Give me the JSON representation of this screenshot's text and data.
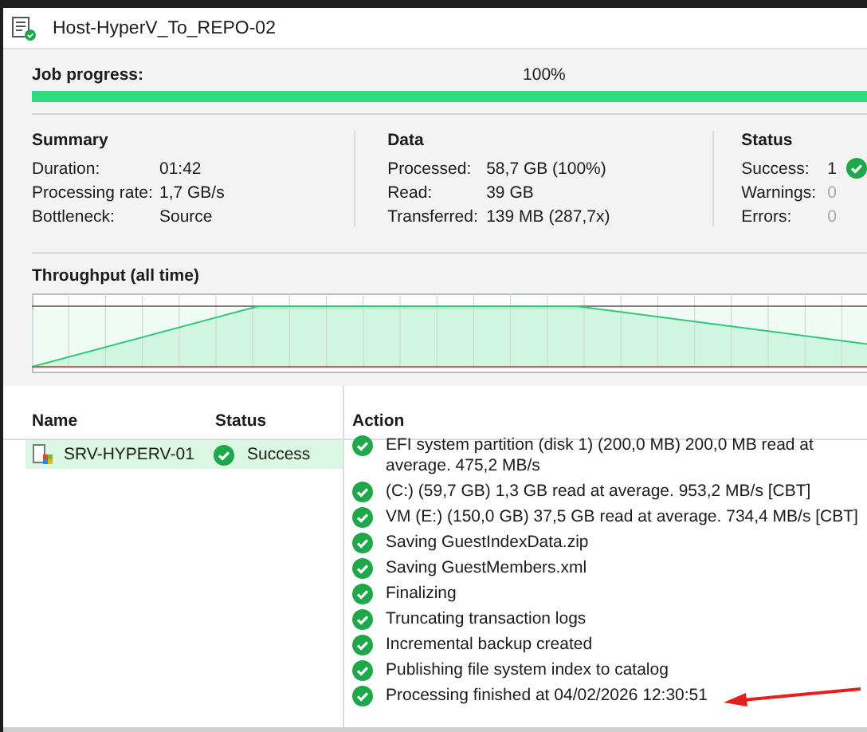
{
  "window": {
    "title": "Host-HyperV_To_REPO-02"
  },
  "job_progress": {
    "label": "Job progress:",
    "percent": "100%",
    "level": 1
  },
  "summary": {
    "title": "Summary",
    "rows": [
      {
        "label": "Duration:",
        "value": "01:42"
      },
      {
        "label": "Processing rate:",
        "value": "1,7 GB/s"
      },
      {
        "label": "Bottleneck:",
        "value": "Source"
      }
    ]
  },
  "data": {
    "title": "Data",
    "rows": [
      {
        "label": "Processed:",
        "value": "58,7 GB (100%)"
      },
      {
        "label": "Read:",
        "value": "39 GB"
      },
      {
        "label": "Transferred:",
        "value": "139 MB (287,7x)"
      }
    ]
  },
  "status": {
    "title": "Status",
    "rows": [
      {
        "label": "Success:",
        "value": "1",
        "kind": "success",
        "dimmed": false
      },
      {
        "label": "Warnings:",
        "value": "0",
        "kind": "warning",
        "dimmed": true
      },
      {
        "label": "Errors:",
        "value": "0",
        "kind": "error",
        "dimmed": true
      }
    ]
  },
  "throughput": {
    "title": "Throughput (all time)"
  },
  "vm_table": {
    "columns": [
      "Name",
      "Status"
    ],
    "rows": [
      {
        "name": "SRV-HYPERV-01",
        "status": "Success",
        "selected": true
      }
    ]
  },
  "action_log": {
    "title": "Action",
    "items": [
      {
        "text": "EFI system partition (disk 1) (200,0 MB) 200,0 MB read at average. 475,2 MB/s",
        "kind": "success",
        "annotated": false
      },
      {
        "text": "(C:) (59,7 GB) 1,3 GB read at average. 953,2 MB/s [CBT]",
        "kind": "success",
        "annotated": false
      },
      {
        "text": "VM (E:) (150,0 GB) 37,5 GB read at average. 734,4 MB/s [CBT]",
        "kind": "success",
        "annotated": false
      },
      {
        "text": "Saving GuestIndexData.zip",
        "kind": "success",
        "annotated": false
      },
      {
        "text": "Saving GuestMembers.xml",
        "kind": "success",
        "annotated": false
      },
      {
        "text": "Finalizing",
        "kind": "success",
        "annotated": false
      },
      {
        "text": "Truncating transaction logs",
        "kind": "success",
        "annotated": false
      },
      {
        "text": "Incremental backup created",
        "kind": "success",
        "annotated": false
      },
      {
        "text": "Publishing file system index to catalog",
        "kind": "success",
        "annotated": false
      },
      {
        "text": "Processing finished at 04/02/2026 12:30:51",
        "kind": "success",
        "annotated": true
      }
    ]
  }
}
